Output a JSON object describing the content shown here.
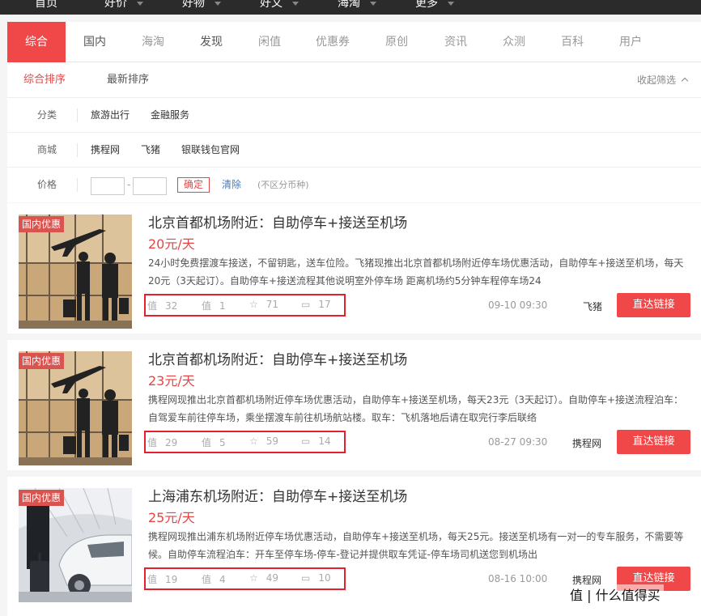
{
  "top_nav": [
    {
      "label": "首页",
      "caret": false
    },
    {
      "label": "好价",
      "caret": true
    },
    {
      "label": "好物",
      "caret": true
    },
    {
      "label": "好文",
      "caret": true
    },
    {
      "label": "海淘",
      "caret": true
    },
    {
      "label": "更多",
      "caret": true
    }
  ],
  "tabs": [
    "综合",
    "国内",
    "海淘",
    "发现",
    "闲值",
    "优惠券",
    "原创",
    "资讯",
    "众测",
    "百科",
    "用户"
  ],
  "sort": {
    "active": "综合排序",
    "other": "最新排序",
    "collapse": "收起筛选"
  },
  "filters": {
    "category": {
      "label": "分类",
      "options": [
        "旅游出行",
        "金融服务"
      ]
    },
    "mall": {
      "label": "商城",
      "options": [
        "携程网",
        "飞猪",
        "银联钱包官网"
      ]
    },
    "price": {
      "label": "价格",
      "confirm": "确定",
      "clear": "清除",
      "note": "(不区分币种)"
    }
  },
  "items": [
    {
      "badge": "国内优惠",
      "title": "北京首都机场附近：自助停车+接送至机场",
      "price": "20元/天",
      "desc": "24小时免费摆渡车接送，不留钥匙，送车位险。飞猪现推出北京首都机场附近停车场优惠活动，自助停车+接送至机场，每天20元（3天起订）。自助停车+接送流程其他说明室外停车场 距离机场约5分钟车程停车场24",
      "worth": "32",
      "unworth": "1",
      "fav": "71",
      "comments": "17",
      "time": "09-10 09:30",
      "merchant": "飞猪",
      "button": "直达链接"
    },
    {
      "badge": "国内优惠",
      "title": "北京首都机场附近：自助停车+接送至机场",
      "price": "23元/天",
      "desc": "携程网现推出北京首都机场附近停车场优惠活动，自助停车+接送至机场，每天23元（3天起订）。自助停车+接送流程泊车：自驾爱车前往停车场，乘坐摆渡车前往机场航站楼。取车：飞机落地后请在取完行李后联络",
      "worth": "29",
      "unworth": "5",
      "fav": "59",
      "comments": "14",
      "time": "08-27 09:30",
      "merchant": "携程网",
      "button": "直达链接"
    },
    {
      "badge": "国内优惠",
      "title": "上海浦东机场附近：自助停车+接送至机场",
      "price": "25元/天",
      "desc": "携程网现推出浦东机场附近停车场优惠活动，自助停车+接送至机场，每天25元。接送至机场有一对一的专车服务，不需要等候。自助停车流程泊车：开车至停车场-停车-登记并提供取车凭证-停车场司机送您到机场出",
      "worth": "19",
      "unworth": "4",
      "fav": "49",
      "comments": "10",
      "time": "08-16 10:00",
      "merchant": "携程网",
      "button": "直达链接"
    }
  ],
  "watermark": "值 | 什么值得买",
  "colors": {
    "accent": "#f04848",
    "highlight_box": "#e3202b",
    "topbar": "#2b2b2b"
  }
}
